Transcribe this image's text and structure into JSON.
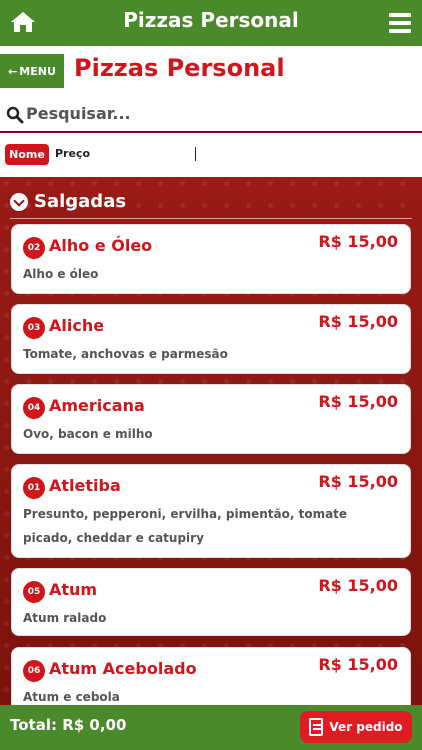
{
  "header": {
    "title": "Pizzas Personal",
    "home_icon": "home-icon",
    "menu_icon": "hamburger-icon"
  },
  "titlebar": {
    "back_label": "MENU",
    "page_title": "Pizzas Personal"
  },
  "search": {
    "placeholder": "Pesquisar..."
  },
  "sort": {
    "name_label": "Nome",
    "price_label": "Preço"
  },
  "category": {
    "label": "Salgadas"
  },
  "items": [
    {
      "code": "02",
      "name": "Alho e Óleo",
      "price": "R$ 15,00",
      "desc": "Alho e óleo"
    },
    {
      "code": "03",
      "name": "Aliche",
      "price": "R$ 15,00",
      "desc": "Tomate, anchovas e parmesão"
    },
    {
      "code": "04",
      "name": "Americana",
      "price": "R$ 15,00",
      "desc": "Ovo, bacon e milho"
    },
    {
      "code": "01",
      "name": "Atletiba",
      "price": "R$ 15,00",
      "desc": "Presunto, pepperoni, ervilha, pimentão, tomate picado, cheddar e catupiry"
    },
    {
      "code": "05",
      "name": "Atum",
      "price": "R$ 15,00",
      "desc": "Atum ralado"
    },
    {
      "code": "06",
      "name": "Atum Acebolado",
      "price": "R$ 15,00",
      "desc": "Atum e cebola"
    }
  ],
  "footer": {
    "total": "Total: R$ 0,00",
    "order_label": "Ver pedido"
  },
  "colors": {
    "green": "#4a8a2a",
    "red": "#d0161c",
    "dark_red": "#8e1410"
  }
}
